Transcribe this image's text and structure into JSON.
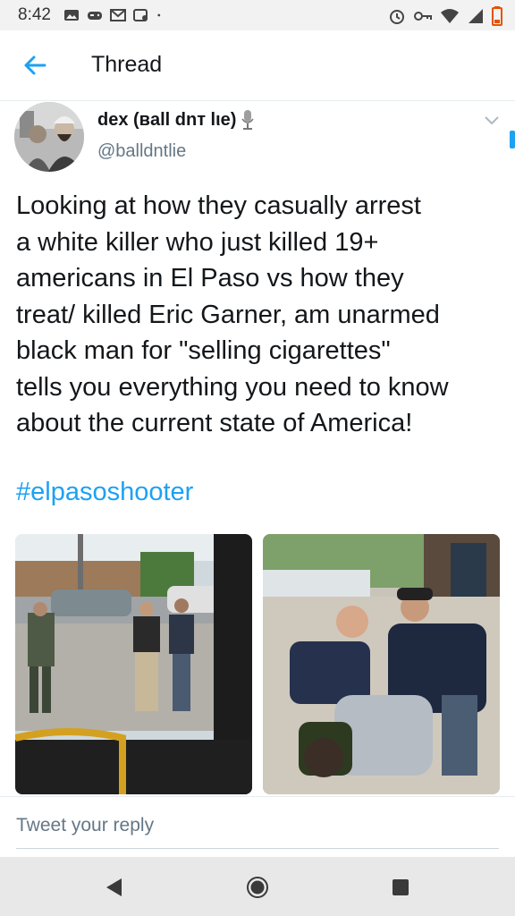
{
  "status_bar": {
    "time": "8:42",
    "notification_icons": [
      "image-icon",
      "gamepad-icon",
      "mail-icon",
      "nfc-icon"
    ],
    "system_icons": [
      "alarm-icon",
      "key-icon",
      "wifi-icon",
      "signal-icon",
      "battery-low-icon"
    ],
    "battery_color": "#e65100"
  },
  "app_bar": {
    "title": "Thread",
    "accent": "#1da1f2"
  },
  "tweet": {
    "author_name": "dex (ʙall dnт lιe)",
    "author_handle": "@balldntlie",
    "text": "Looking at how they casually arrest\na white killer who just killed 19+\namericans in El Paso vs how they\ntreat/ killed Eric Garner, am unarmed\nblack man for \"selling cigarettes\"\ntells you everything you need to know\nabout the current state of America!",
    "hashtag": "#elpasoshooter",
    "media": [
      "photo",
      "photo"
    ]
  },
  "reply": {
    "placeholder": "Tweet your reply"
  },
  "navigation": {
    "buttons": [
      "back-triangle-icon",
      "home-circle-icon",
      "recents-square-icon"
    ]
  }
}
